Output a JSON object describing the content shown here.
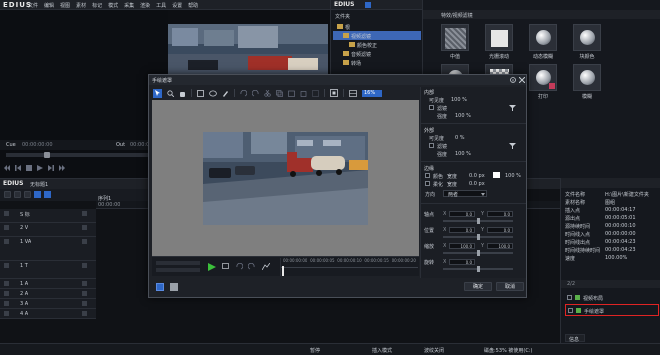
{
  "app": {
    "name": "EDIUS",
    "menu": [
      "文件",
      "编辑",
      "视图",
      "素材",
      "标记",
      "模式",
      "采集",
      "渲染",
      "工具",
      "设置",
      "帮助"
    ]
  },
  "player": {
    "label_cue": "Cue",
    "timecode_cue": "00:00:00:00",
    "label_out": "Out",
    "timecode_out": "00:00:00:00"
  },
  "timeline": {
    "app_name": "EDIUS",
    "seq_name": "无标题1",
    "seq_tab": "序列1",
    "ruler": [
      "00:00:00",
      "00:00:10:00"
    ],
    "tracks": [
      {
        "label": "S 标",
        "type": "s"
      },
      {
        "label": "2 V",
        "type": "v"
      },
      {
        "label": "1 VA",
        "type": "va"
      },
      {
        "label": "1 T",
        "type": "t"
      },
      {
        "label": "1 A",
        "type": "a"
      },
      {
        "label": "2 A",
        "type": "a"
      },
      {
        "label": "3 A",
        "type": "a"
      },
      {
        "label": "4 A",
        "type": "a"
      }
    ]
  },
  "bin": {
    "title": "文件夹",
    "tree": [
      {
        "label": "根",
        "indent": 0
      },
      {
        "label": "视频滤镜",
        "indent": 1
      },
      {
        "label": "颜色校正",
        "indent": 2
      },
      {
        "label": "音频滤镜",
        "indent": 1
      },
      {
        "label": "转场",
        "indent": 1
      }
    ]
  },
  "effects": {
    "title": "特效/视频滤镜",
    "items": [
      {
        "label": "中值"
      },
      {
        "label": "光栅滚动"
      },
      {
        "label": "动态模糊"
      },
      {
        "label": "块颜色"
      },
      {
        "label": "平滑模糊"
      },
      {
        "label": "平滑马赛克"
      },
      {
        "label": "打印"
      },
      {
        "label": "模糊"
      }
    ]
  },
  "dialog": {
    "title": "手绘遮罩",
    "zoom": "16%",
    "timecodes": [
      "00:00:00:00",
      "00:00:00:05",
      "00:00:00:10",
      "00:00:00:15",
      "00:00:00:20",
      "00:00:01:00"
    ],
    "buttons": {
      "ok": "确定",
      "cancel": "取消"
    },
    "props": {
      "inner": {
        "title": "内部",
        "opacity_label": "可见度",
        "opacity": "100 %",
        "filter_label": "滤镜",
        "strength_label": "强度",
        "strength": "100 %"
      },
      "outer": {
        "title": "外部",
        "opacity_label": "可见度",
        "opacity": "0 %",
        "filter_label": "滤镜",
        "strength_label": "强度",
        "strength": "100 %"
      },
      "edge": {
        "title": "边缘",
        "color_label": "颜色",
        "width_label": "宽度",
        "width": "0.0 px",
        "opacity": "100 %",
        "soft_label": "柔化",
        "soft_width_label": "宽度",
        "soft_width": "0.0 px",
        "dir_label": "方向",
        "dir_value": "两者"
      },
      "transform": [
        {
          "label": "轴点",
          "x": "0.0",
          "y": "0.0"
        },
        {
          "label": "位置",
          "x": "0.0",
          "y": "0.0"
        },
        {
          "label": "缩放",
          "x": "100.0",
          "y": "100.0"
        },
        {
          "label": "旋转",
          "x": "0.0",
          "y": ""
        }
      ]
    }
  },
  "info": {
    "rows": [
      {
        "k": "文件名称",
        "v": "H:\\图片\\新建文件夹"
      },
      {
        "k": "素材名称",
        "v": "图组"
      },
      {
        "k": "插入点",
        "v": "00:00:04:17"
      },
      {
        "k": "源出点",
        "v": "00:00:05:01"
      },
      {
        "k": "源持续时间",
        "v": "00:00:00:10"
      },
      {
        "k": "时间线入点",
        "v": "00:00:00:00"
      },
      {
        "k": "时间线出点",
        "v": "00:00:04:23"
      },
      {
        "k": "时间线持续时间",
        "v": "00:00:04:23"
      },
      {
        "k": "速度",
        "v": "100.00%"
      }
    ],
    "layer_count": "2/2",
    "filters": [
      {
        "label": "视频布局",
        "selected": false
      },
      {
        "label": "手绘遮罩",
        "selected": true
      }
    ],
    "tab": "信息"
  },
  "status": {
    "items": [
      "暂停",
      "插入模式",
      "波纹关闭",
      "磁盘:53% 被使用(C:)"
    ]
  },
  "colors": {
    "accent": "#2e67c7",
    "highlight_box": "#e02424",
    "selected": "#3d67b6"
  }
}
